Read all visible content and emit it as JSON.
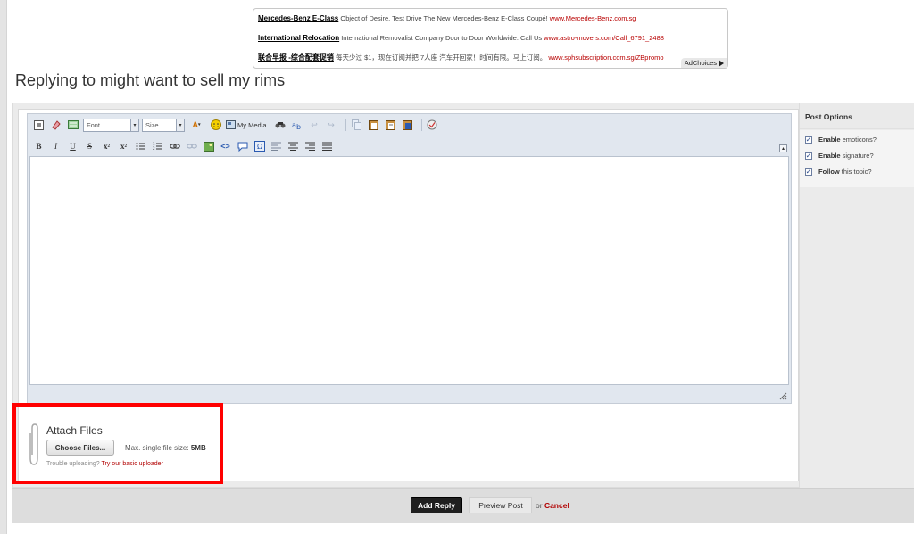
{
  "ads": [
    {
      "title": "Mercedes-Benz E-Class",
      "text": "Object of Desire. Test Drive The New Mercedes-Benz E-Class Coupé!",
      "url": "www.Mercedes-Benz.com.sg"
    },
    {
      "title": "International Relocation",
      "text": "International Removalist Company Door to Door Worldwide. Call Us",
      "url": "www.astro-movers.com/Call_6791_2488"
    },
    {
      "title": "联合早报 -综合配套促销",
      "text": "每天少过 $1，现在订阅并把 7人座 汽车开回家！时间有限。马上订阅。",
      "url": "www.sphsubscription.com.sg/ZBpromo"
    }
  ],
  "ad_choices": "AdChoices",
  "page_title": "Replying to might want to sell my rims",
  "toolbar": {
    "font_select": "Font",
    "size_select": "Size",
    "my_media": "My Media"
  },
  "attach": {
    "title": "Attach Files",
    "choose_button": "Choose Files...",
    "max_label": "Max. single file size:",
    "max_value": "5MB",
    "trouble_text": "Trouble uploading?",
    "trouble_link": "Try our basic uploader"
  },
  "post_options": {
    "title": "Post Options",
    "items": [
      {
        "bold": "Enable",
        "rest": "emoticons?",
        "checked": true
      },
      {
        "bold": "Enable",
        "rest": "signature?",
        "checked": true
      },
      {
        "bold": "Follow",
        "rest": "this topic?",
        "checked": true
      }
    ]
  },
  "footer": {
    "add_reply": "Add Reply",
    "preview": "Preview Post",
    "or": "or",
    "cancel": "Cancel"
  }
}
